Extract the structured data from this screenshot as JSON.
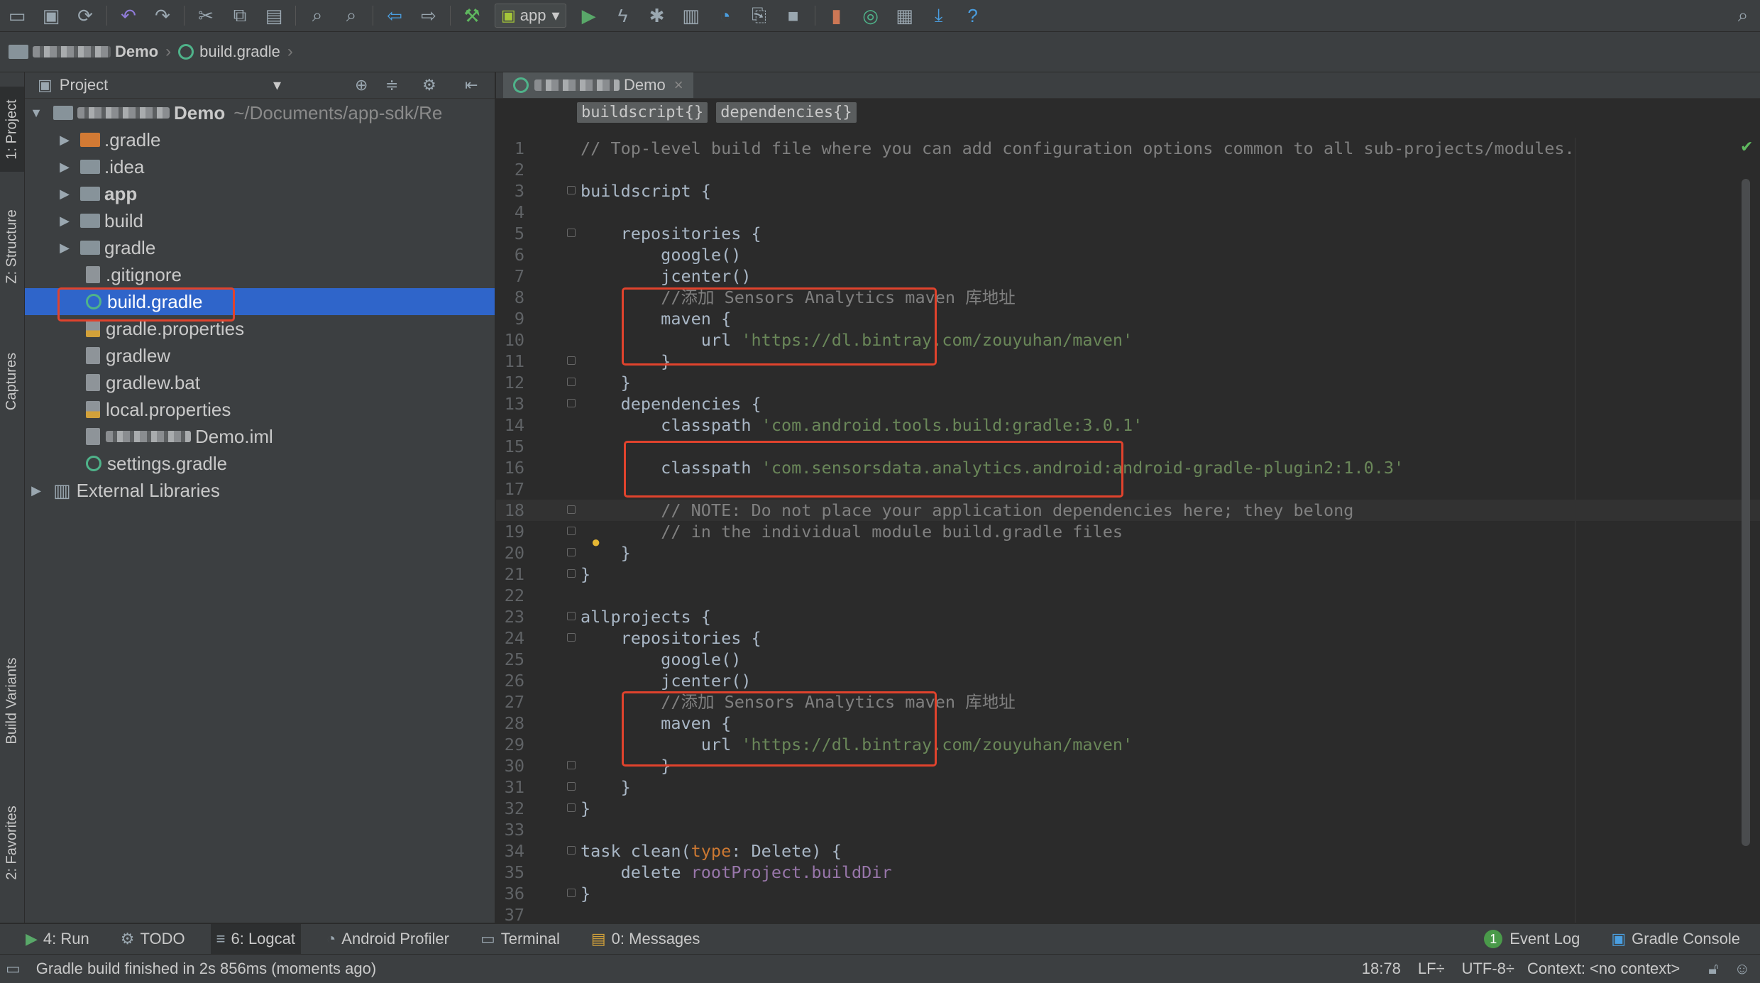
{
  "toolbar": {
    "run_config": "app",
    "icons": [
      "open-icon",
      "save-icon",
      "sync-icon",
      "undo-icon",
      "redo-icon",
      "cut-icon",
      "copy-icon",
      "paste-icon",
      "find-icon",
      "replace-icon",
      "back-icon",
      "forward-icon",
      "build-icon",
      "run-icon",
      "apply-changes-icon",
      "debug-icon",
      "profile-icon",
      "attach-icon",
      "stop-icon",
      "sdk-manager-icon",
      "sync-gradle-icon",
      "project-structure-icon",
      "download-icon",
      "help-icon",
      "search-icon"
    ]
  },
  "navbar": {
    "project_suffix": "Demo",
    "file": "build.gradle"
  },
  "side_tabs": {
    "project": "1: Project",
    "structure": "Z: Structure",
    "captures": "Captures",
    "build_variants": "Build Variants",
    "favorites": "2: Favorites"
  },
  "project_panel": {
    "title": "Project",
    "root_name": "Demo",
    "root_path": "~/Documents/app-sdk/Re",
    "items": [
      {
        "label": ".gradle"
      },
      {
        "label": ".idea"
      },
      {
        "label": "app"
      },
      {
        "label": "build"
      },
      {
        "label": "gradle"
      },
      {
        "label": ".gitignore"
      },
      {
        "label": "build.gradle"
      },
      {
        "label": "gradle.properties"
      },
      {
        "label": "gradlew"
      },
      {
        "label": "gradlew.bat"
      },
      {
        "label": "local.properties"
      },
      {
        "label": "Demo.iml"
      },
      {
        "label": "settings.gradle"
      },
      {
        "label": "External Libraries"
      }
    ]
  },
  "editor": {
    "tab_label": "Demo",
    "breadcrumbs": [
      "buildscript{}",
      "dependencies{}"
    ],
    "lines": [
      "// Top-level build file where you can add configuration options common to all sub-projects/modules.",
      "",
      "buildscript {",
      "",
      "    repositories {",
      "        google()",
      "        jcenter()",
      "        //添加 Sensors Analytics maven 库地址",
      "        maven {",
      "            url 'https://dl.bintray.com/zouyuhan/maven'",
      "        }",
      "    }",
      "    dependencies {",
      "        classpath 'com.android.tools.build:gradle:3.0.1'",
      "",
      "        classpath 'com.sensorsdata.analytics.android:android-gradle-plugin2:1.0.3'",
      "",
      "        // NOTE: Do not place your application dependencies here; they belong",
      "        // in the individual module build.gradle files",
      "    }",
      "}",
      "",
      "allprojects {",
      "    repositories {",
      "        google()",
      "        jcenter()",
      "        //添加 Sensors Analytics maven 库地址",
      "        maven {",
      "            url 'https://dl.bintray.com/zouyuhan/maven'",
      "        }",
      "    }",
      "}",
      "",
      "task clean(type: Delete) {",
      "    delete rootProject.buildDir",
      "}",
      ""
    ]
  },
  "bottom_tabs": [
    {
      "label": "4: Run"
    },
    {
      "label": "TODO"
    },
    {
      "label": "6: Logcat"
    },
    {
      "label": "Android Profiler"
    },
    {
      "label": "Terminal"
    },
    {
      "label": "0: Messages"
    }
  ],
  "bottom_right_tabs": [
    {
      "label": "Event Log",
      "badge": "1"
    },
    {
      "label": "Gradle Console"
    }
  ],
  "status": {
    "message": "Gradle build finished in 2s 856ms (moments ago)",
    "position": "18:78",
    "line_sep": "LF÷",
    "encoding": "UTF-8÷",
    "context": "Context: <no context>"
  },
  "colors": {
    "highlight_box": "#e0432d",
    "selection": "#2f65ca",
    "string": "#6a8759",
    "comment": "#808080"
  }
}
